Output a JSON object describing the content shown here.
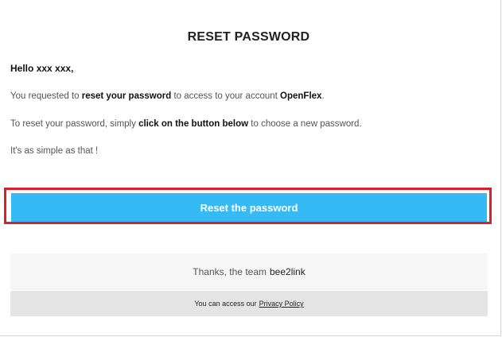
{
  "email": {
    "title": "RESET PASSWORD",
    "greeting_prefix": "Hello",
    "user_name": "xxx xxx,",
    "p1_a": "You requested to",
    "p1_b": "reset your password",
    "p1_c": "to access to your account",
    "p1_d": "OpenFlex",
    "p1_e": ".",
    "p2_a": "To reset your password, simply",
    "p2_b": "click on the button below",
    "p2_c": "to choose a new password.",
    "p3": "It's as simple as that !",
    "button_label": "Reset the password"
  },
  "footer": {
    "thanks_text": "Thanks, the team",
    "brand": "bee2link",
    "access_text": "You can access our",
    "privacy_link": "Privacy Policy"
  },
  "colors": {
    "button": "#35baf6",
    "highlight": "#d9212c"
  }
}
